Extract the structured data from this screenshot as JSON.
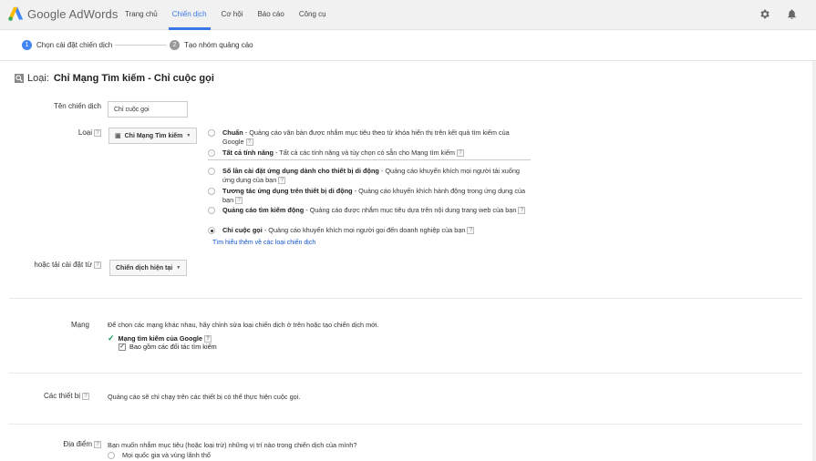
{
  "app": {
    "logo_text": "Google AdWords",
    "nav": [
      "Trang chủ",
      "Chiến dịch",
      "Cơ hội",
      "Báo cáo",
      "Công cụ"
    ],
    "active_nav": "Chiến dịch"
  },
  "stepper": {
    "step1": {
      "num": "1",
      "label": "Chọn cài đặt chiến dịch"
    },
    "step2": {
      "num": "2",
      "label": "Tạo nhóm quảng cáo"
    }
  },
  "header": {
    "type_label": "Loại:",
    "type_value": "Chỉ Mạng Tìm kiếm - Chỉ cuộc gọi"
  },
  "form": {
    "name_label": "Tên chiến dịch",
    "name_value": "Chỉ cuộc gọi",
    "type_label": "Loại",
    "type_dropdown": "Chỉ Mạng Tìm kiếm",
    "help": "?",
    "options": [
      {
        "title": "Chuẩn",
        "desc": " - Quảng cáo văn bản được nhắm mục tiêu theo từ khóa hiển thị trên kết quả tìm kiếm của Google",
        "checked": false
      },
      {
        "title": "Tất cả tính năng",
        "desc": " - Tất cả các tính năng và tùy chọn có sẵn cho Mạng tìm kiếm",
        "checked": false
      },
      {
        "title": "Số lần cài đặt ứng dụng dành cho thiết bị di động",
        "desc": " - Quảng cáo khuyến khích mọi người tải xuống ứng dụng của bạn",
        "checked": false
      },
      {
        "title": "Tương tác ứng dụng trên thiết bị di động",
        "desc": " - Quảng cáo khuyến khích hành động trong ứng dụng của bạn",
        "checked": false
      },
      {
        "title": "Quảng cáo tìm kiếm động",
        "desc": " - Quảng cáo được nhắm mục tiêu dựa trên nội dung trang web của bạn",
        "checked": false
      },
      {
        "title": "Chỉ cuộc gọi",
        "desc": " - Quảng cáo khuyến khích mọi người gọi đến doanh nghiệp của bạn",
        "checked": true
      }
    ],
    "learn_more": "Tìm hiểu thêm về các loại chiến dịch",
    "load_label": "hoặc tải cài đặt từ",
    "load_dropdown": "Chiến dịch hiện tại"
  },
  "network": {
    "label": "Mạng",
    "desc": "Để chọn các mạng khác nhau, hãy chỉnh sửa loại chiến dịch ở trên hoặc tạo chiến dịch mới.",
    "google_search": "Mạng tìm kiếm của Google",
    "include_partners": "Bao gồm các đối tác tìm kiếm"
  },
  "devices": {
    "label": "Các thiết bị",
    "desc": "Quảng cáo sẽ chỉ chạy trên các thiết bị có thể thực hiện cuộc gọi."
  },
  "locations": {
    "label": "Địa điểm",
    "desc": "Bạn muốn nhắm mục tiêu (hoặc loại trừ) những vị trí nào trong chiến dịch của mình?",
    "option1": "Mọi quốc gia và vùng lãnh thổ"
  }
}
